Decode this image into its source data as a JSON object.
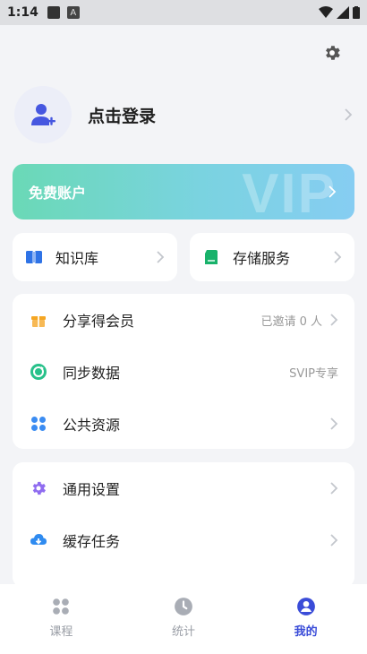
{
  "status_bar": {
    "time": "1:14",
    "app_badge": "A"
  },
  "profile": {
    "login_label": "点击登录"
  },
  "vip_card": {
    "label": "免费账户",
    "watermark": "VIP"
  },
  "shortcuts": [
    {
      "label": "知识库",
      "icon": "book-icon"
    },
    {
      "label": "存储服务",
      "icon": "sd-card-icon"
    }
  ],
  "list1": [
    {
      "label": "分享得会员",
      "value": "已邀请 0 人",
      "icon": "gift-icon"
    },
    {
      "label": "同步数据",
      "value": "SVIP专享",
      "icon": "sync-icon"
    },
    {
      "label": "公共资源",
      "value": "",
      "icon": "grid-icon"
    }
  ],
  "list2": [
    {
      "label": "通用设置",
      "icon": "gear-icon"
    },
    {
      "label": "缓存任务",
      "icon": "cloud-download-icon"
    }
  ],
  "bottom_nav": [
    {
      "label": "课程",
      "icon": "grid-icon",
      "active": false
    },
    {
      "label": "统计",
      "icon": "clock-icon",
      "active": false
    },
    {
      "label": "我的",
      "icon": "user-icon",
      "active": true
    }
  ],
  "colors": {
    "accent": "#3a4cd8",
    "vip_start": "#6ad9b6",
    "vip_end": "#86cdf2",
    "background": "#f3f4f7"
  }
}
